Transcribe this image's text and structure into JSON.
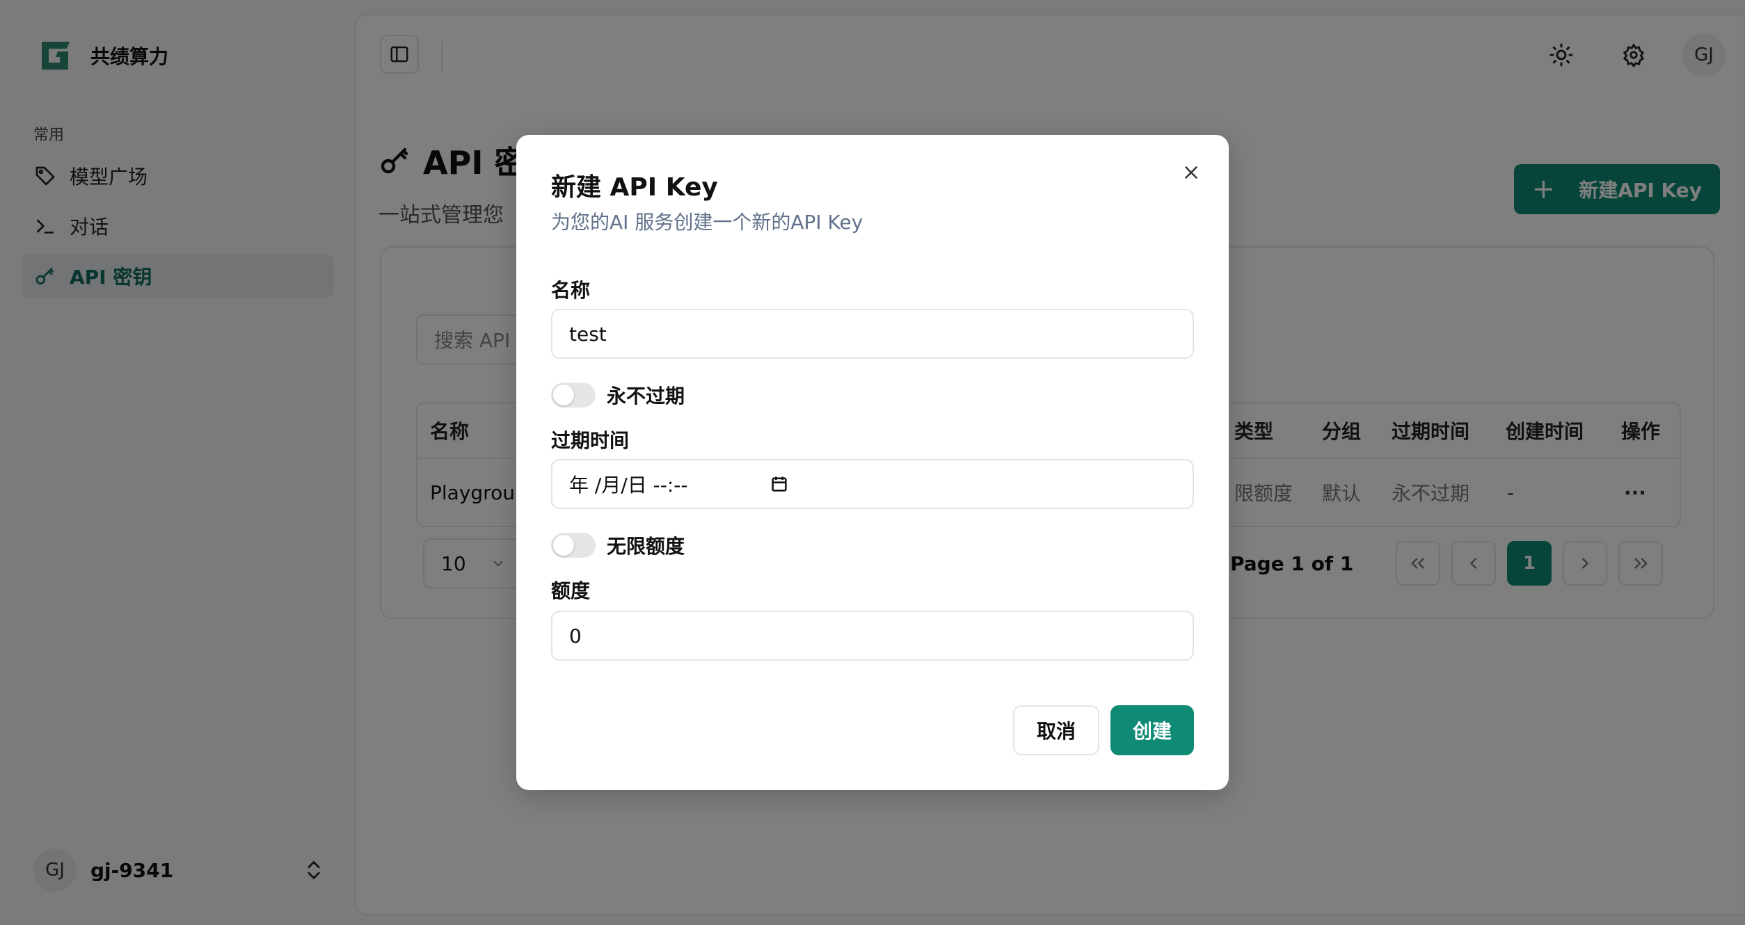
{
  "brand": {
    "name": "共绩算力",
    "accent": "#0f8a75"
  },
  "sidebar": {
    "section_label": "常用",
    "items": [
      {
        "label": "模型广场",
        "icon": "tag-icon"
      },
      {
        "label": "对话",
        "icon": "terminal-icon"
      },
      {
        "label": "API 密钥",
        "icon": "key-icon",
        "active": true
      }
    ],
    "user": {
      "initials": "GJ",
      "name": "gj-9341"
    }
  },
  "topbar": {
    "avatar_initials": "GJ"
  },
  "page": {
    "title": "API 密",
    "subtitle": "一站式管理您",
    "new_button": "新建API Key"
  },
  "search": {
    "placeholder": "搜索 API I"
  },
  "table": {
    "headers": [
      "名称",
      "类型",
      "分组",
      "过期时间",
      "创建时间",
      "操作"
    ],
    "rows": [
      {
        "name": "Playgroun",
        "type": "限额度",
        "group": "默认",
        "expires": "永不过期",
        "created": "-",
        "actions": "···"
      }
    ]
  },
  "pagination": {
    "page_size": "10",
    "info": "Page 1 of 1",
    "current": "1"
  },
  "modal": {
    "title": "新建 API Key",
    "description": "为您的AI 服务创建一个新的API Key",
    "name_label": "名称",
    "name_value": "test",
    "never_expire_label": "永不过期",
    "never_expire_on": false,
    "expire_label": "过期时间",
    "expire_placeholder": "年 /月/日 --:--",
    "unlimited_label": "无限额度",
    "unlimited_on": false,
    "quota_label": "额度",
    "quota_value": "0",
    "cancel": "取消",
    "create": "创建"
  }
}
